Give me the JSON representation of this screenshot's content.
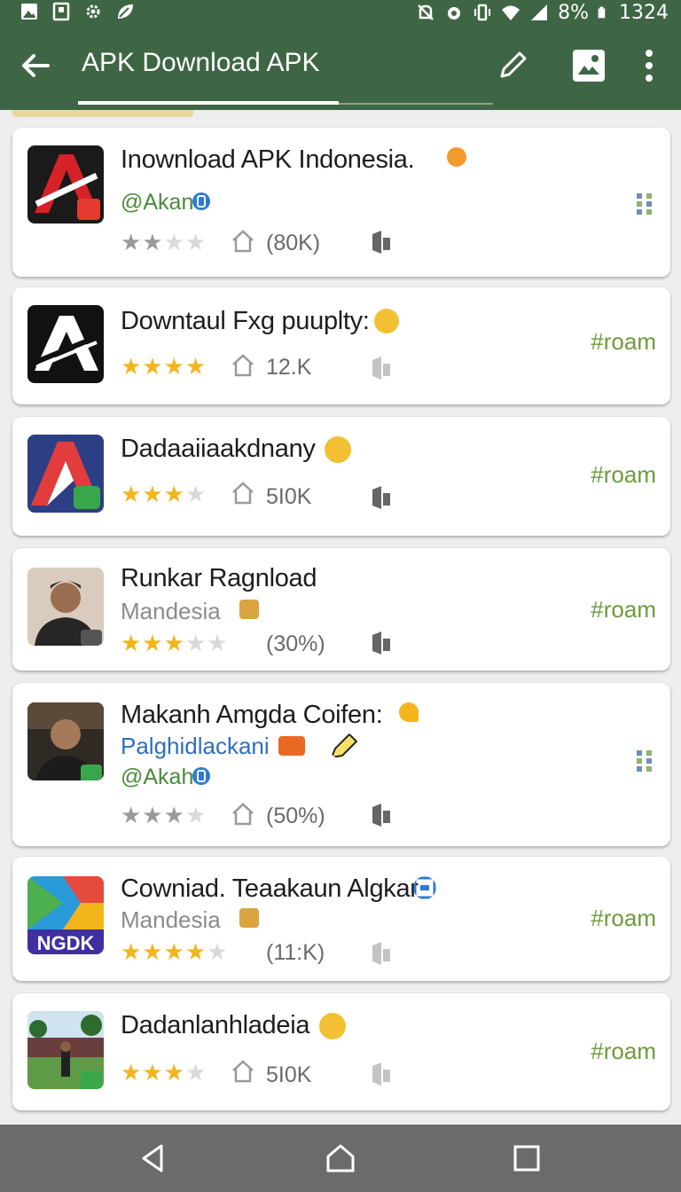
{
  "status_bar": {
    "battery_percent": "8%",
    "time": "1324",
    "icons": [
      "image-icon",
      "save-icon",
      "settings-icon",
      "leaf-icon",
      "mute-icon",
      "alarm-icon",
      "vibrate-icon",
      "wifi-icon",
      "signal-icon",
      "battery-icon"
    ]
  },
  "app_bar": {
    "title": "APK Download APK",
    "actions": [
      "back-icon",
      "pencil-icon",
      "image-edit-icon",
      "more-vert-icon"
    ],
    "colors": {
      "bar": "#3e6644",
      "accent": "#6f9a3c",
      "star": "#f3b51c"
    }
  },
  "apps": [
    {
      "name": "Inownload APK Indonesia.",
      "developer": "@Akan",
      "rating_stars": 2,
      "rating_text": "(80K)",
      "action": "grid",
      "icon": "red-a-logo"
    },
    {
      "name": "Downtaul Fxg puuplty:",
      "rating_stars": 4,
      "rating_text": "12.K",
      "action_label": "#roam",
      "icon": "white-a-logo"
    },
    {
      "name": "Dadaaiiaakdnany",
      "rating_stars": 3,
      "rating_text": "5I0K",
      "action_label": "#roam",
      "icon": "blue-a-logo"
    },
    {
      "name": "Runkar Ragnload",
      "developer": "Mandesia",
      "rating_stars": 3,
      "rating_text": "(30%)",
      "action_label": "#roam",
      "icon": "person-photo"
    },
    {
      "name": "Makanh Amgda Coifen:",
      "developer_blue": "Palghidlackani",
      "developer": "@Akah",
      "rating_stars": 3,
      "rating_text": "(50%)",
      "action": "grid",
      "icon": "person-photo-2"
    },
    {
      "name": "Cowniad. Teaakaun Algkar",
      "developer": "Mandesia",
      "rating_stars": 4,
      "rating_text": "(11:K)",
      "action_label": "#roam",
      "icon": "ngdk-logo",
      "icon_text": "NGDK"
    },
    {
      "name": "Dadanlanhladeia",
      "rating_stars": 3,
      "rating_text": "5I0K",
      "action_label": "#roam",
      "icon": "park-photo"
    }
  ],
  "nav_bar": {
    "buttons": [
      "back-triangle-icon",
      "home-icon",
      "recents-icon"
    ]
  }
}
